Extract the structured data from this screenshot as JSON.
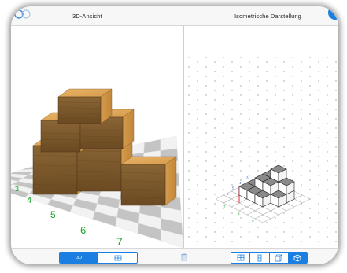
{
  "header": {
    "left_title": "3D-Ansicht",
    "right_title": "Isometrische Darstellung"
  },
  "scene3d": {
    "axis_labels": [
      "4",
      "5",
      "6",
      "7"
    ],
    "axis_color": "#17a82b"
  },
  "isometric": {
    "corner_labels": [
      "3",
      "4",
      "5",
      "6",
      "7",
      "8",
      "9"
    ]
  },
  "toolbar": {
    "mode_3d_label": "3D",
    "accent_color": "#1a7fe0"
  }
}
